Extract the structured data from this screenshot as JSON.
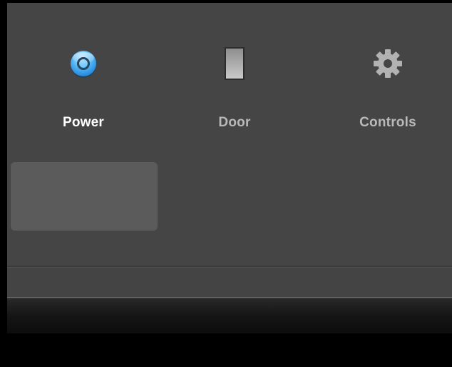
{
  "tabs": [
    {
      "label": "Power",
      "icon": "power-icon",
      "active": true
    },
    {
      "label": "Door",
      "icon": "door-icon",
      "active": false
    },
    {
      "label": "Controls",
      "icon": "gear-icon",
      "active": false
    }
  ],
  "colors": {
    "background": "#454545",
    "active_label": "#ffffff",
    "inactive_label": "#b9b9b9",
    "power_icon_blue": "#3aa6ee",
    "selected_panel": "#5b5b5b"
  }
}
